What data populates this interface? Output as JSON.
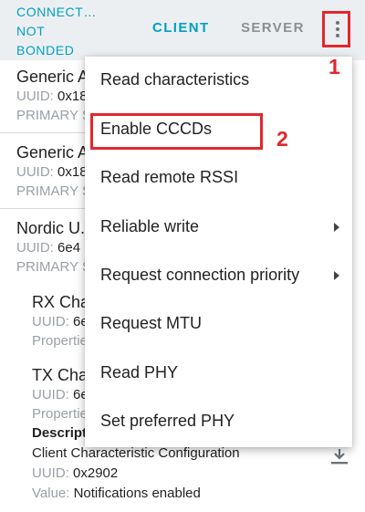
{
  "header": {
    "status_line1": "CONNECT…",
    "status_line2": "NOT",
    "status_line3": "BONDED",
    "tabs": [
      {
        "label": "CLIENT",
        "active": true
      },
      {
        "label": "SERVER",
        "active": false
      }
    ],
    "overflow_icon": "more-vert-icon"
  },
  "annotations": {
    "marker_1": "1",
    "marker_2": "2"
  },
  "services": [
    {
      "name": "Generic A",
      "uuid_label": "UUID:",
      "uuid_value": "0x18",
      "type": "PRIMARY S"
    },
    {
      "name": "Generic A",
      "uuid_label": "UUID:",
      "uuid_value": "0x18",
      "type": "PRIMARY S"
    },
    {
      "name": "Nordic U.",
      "uuid_label": "UUID:",
      "uuid_value": "6e4",
      "type": "PRIMARY S"
    }
  ],
  "characteristics": [
    {
      "name": "RX Cha",
      "uuid_label": "UUID:",
      "uuid_value": "6e",
      "properties": "Propertie"
    },
    {
      "name": "TX Cha",
      "uuid_label": "UUID:",
      "uuid_value": "6e",
      "properties": "Propertie"
    }
  ],
  "descriptor": {
    "header": "Descript",
    "name": "Client Characteristic Configuration",
    "uuid_label": "UUID:",
    "uuid_value": "0x2902",
    "value_label": "Value:",
    "value": "Notifications enabled",
    "action_icon": "download-icon"
  },
  "menu": {
    "items": [
      {
        "label": "Read characteristics",
        "submenu": false
      },
      {
        "label": "Enable CCCDs",
        "submenu": false
      },
      {
        "label": "Read remote RSSI",
        "submenu": false
      },
      {
        "label": "Reliable write",
        "submenu": true
      },
      {
        "label": "Request connection priority",
        "submenu": true
      },
      {
        "label": "Request MTU",
        "submenu": false
      },
      {
        "label": "Read PHY",
        "submenu": false
      },
      {
        "label": "Set preferred PHY",
        "submenu": false
      }
    ]
  },
  "colors": {
    "accent": "#00a0c4",
    "annotation": "#e0282d",
    "toolbar_bg": "#eceff2"
  }
}
